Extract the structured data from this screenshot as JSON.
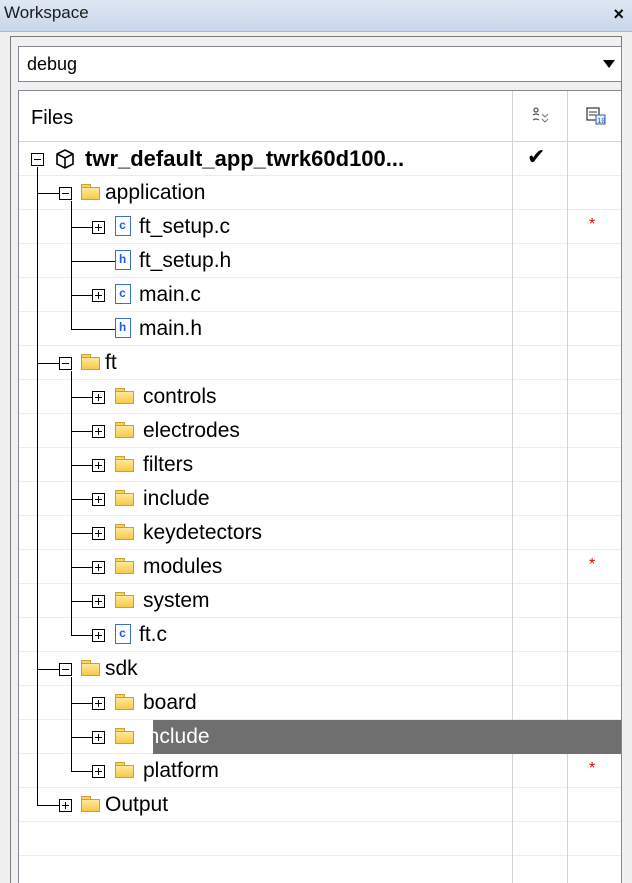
{
  "window": {
    "title": "Workspace",
    "close_glyph": "×"
  },
  "config": {
    "selected": "debug"
  },
  "header": {
    "files_label": "Files",
    "col2_icon": "check-column-icon",
    "col3_icon": "options-column-icon"
  },
  "tree": [
    {
      "label": "twr_default_app_twrk60d100...",
      "checked": "✔",
      "star": ""
    },
    {
      "label": "application",
      "star": ""
    },
    {
      "label": "ft_setup.c",
      "badge": "c",
      "star": "*"
    },
    {
      "label": "ft_setup.h",
      "badge": "h",
      "star": ""
    },
    {
      "label": "main.c",
      "badge": "c",
      "star": ""
    },
    {
      "label": "main.h",
      "badge": "h",
      "star": ""
    },
    {
      "label": "ft",
      "star": ""
    },
    {
      "label": "controls",
      "star": ""
    },
    {
      "label": "electrodes",
      "star": ""
    },
    {
      "label": "filters",
      "star": ""
    },
    {
      "label": "include",
      "star": ""
    },
    {
      "label": "keydetectors",
      "star": ""
    },
    {
      "label": "modules",
      "star": "*"
    },
    {
      "label": "system",
      "star": ""
    },
    {
      "label": "ft.c",
      "badge": "c",
      "star": ""
    },
    {
      "label": "sdk",
      "star": ""
    },
    {
      "label": "board",
      "star": ""
    },
    {
      "label": "include",
      "star": "",
      "selected": true
    },
    {
      "label": "platform",
      "star": "*"
    },
    {
      "label": "Output",
      "star": ""
    }
  ]
}
